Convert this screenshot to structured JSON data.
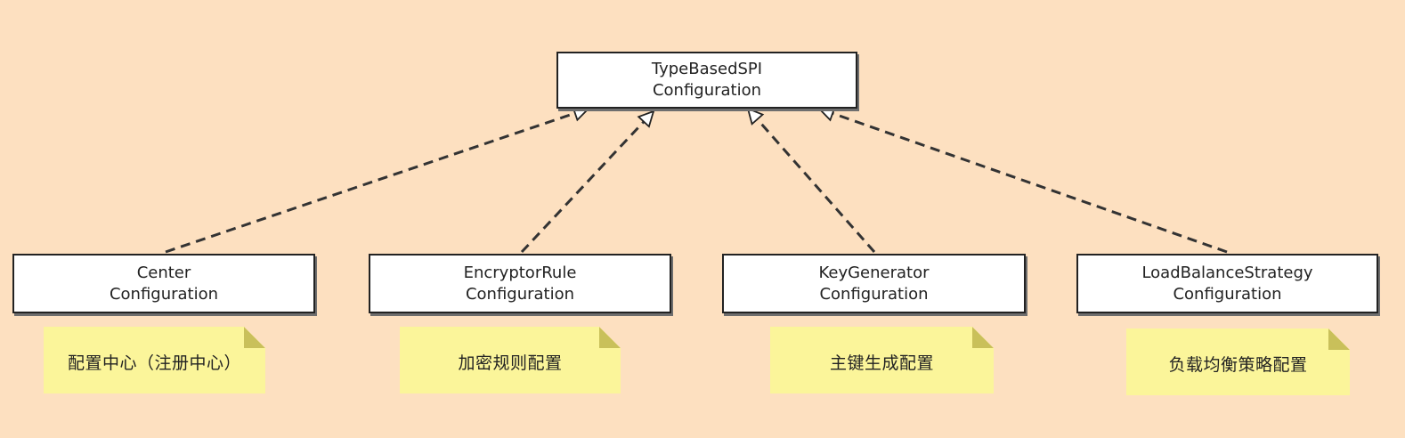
{
  "diagram": {
    "base": {
      "line1": "TypeBasedSPI",
      "line2": "Configuration"
    },
    "children": [
      {
        "line1": "Center",
        "line2": "Configuration",
        "note": "配置中心（注册中心）"
      },
      {
        "line1": "EncryptorRule",
        "line2": "Configuration",
        "note": "加密规则配置"
      },
      {
        "line1": "KeyGenerator",
        "line2": "Configuration",
        "note": "主键生成配置"
      },
      {
        "line1": "LoadBalanceStrategy",
        "line2": "Configuration",
        "note": "负载均衡策略配置"
      }
    ],
    "relation": "realization"
  },
  "colors": {
    "background": "#fde0c0",
    "box_fill": "#ffffff",
    "box_border": "#222222",
    "note_fill": "#fbf59a",
    "note_fold": "#c9c05a",
    "edge": "#333333"
  }
}
